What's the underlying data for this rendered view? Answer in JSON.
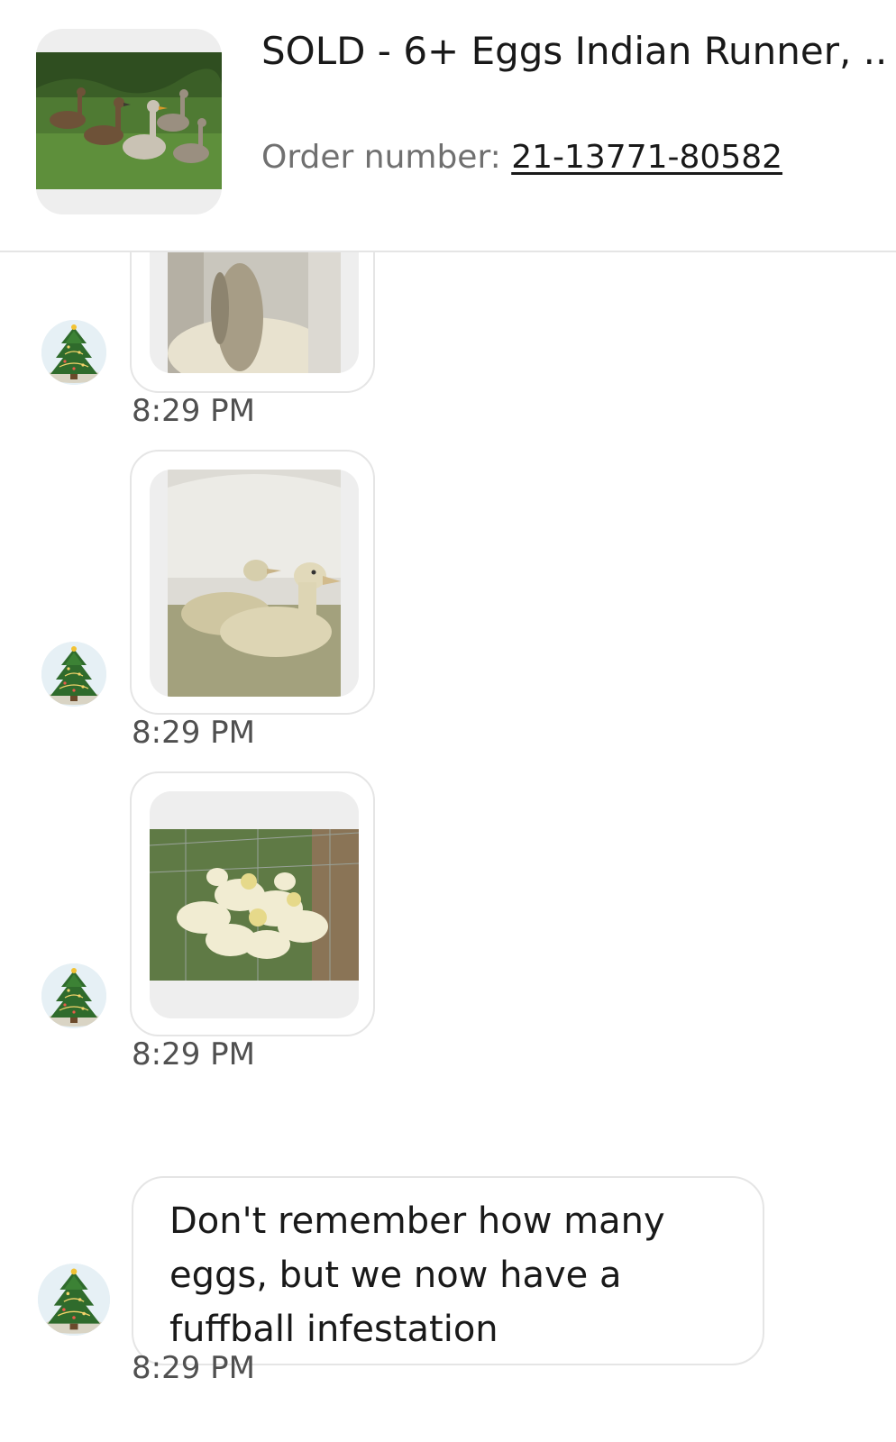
{
  "header": {
    "item_image_icon": "runner-ducks-photo",
    "title": "SOLD - 6+ Eggs Indian Runner, ...",
    "order_label": "Order number: ",
    "order_number": "21-13771-80582"
  },
  "messages": [
    {
      "type": "image",
      "image_icon": "ducklings-in-tub-photo",
      "time": "8:29 PM"
    },
    {
      "type": "image",
      "image_icon": "ducklings-in-water-photo",
      "time": "8:29 PM"
    },
    {
      "type": "image",
      "image_icon": "ducklings-on-grass-photo",
      "time": "8:29 PM"
    },
    {
      "type": "text",
      "text": "Don't remember how many eggs, but we now have a fuffball infestation",
      "time": "8:29 PM"
    }
  ],
  "sender_avatar_icon": "christmas-tree-avatar",
  "colors": {
    "border": "#e5e5e5",
    "thumb_bg": "#eeeeee",
    "time_text": "#505050",
    "order_label": "#707070"
  }
}
